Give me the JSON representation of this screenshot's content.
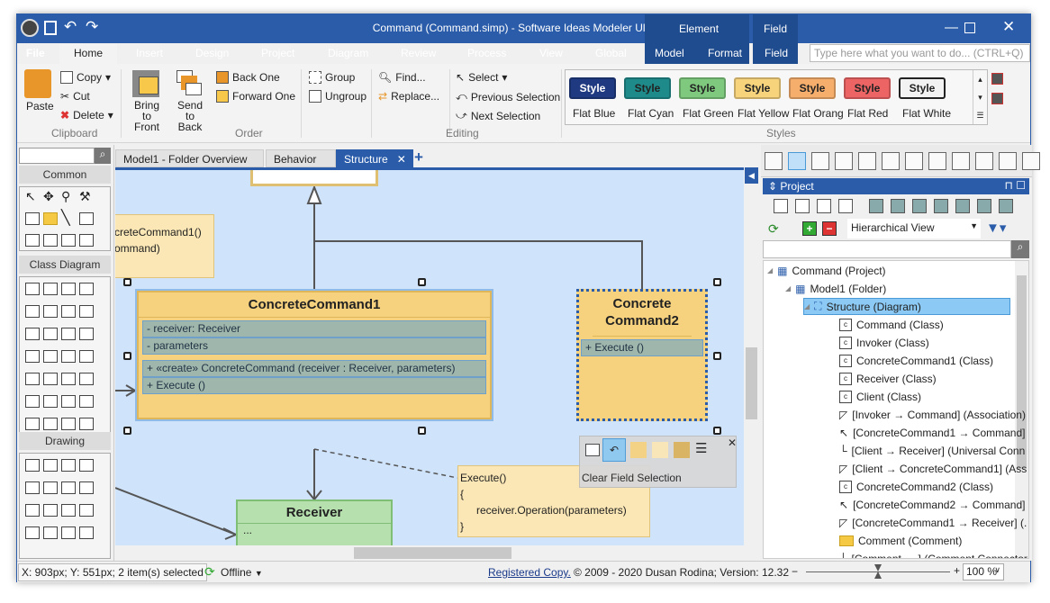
{
  "window": {
    "title": "Command (Command.simp) - Software Ideas Modeler Ultimate",
    "context_groups": [
      "Element",
      "Field"
    ]
  },
  "menu": {
    "tabs": [
      "File",
      "Home",
      "Insert",
      "Design",
      "Project",
      "Diagram",
      "Review",
      "Process",
      "View",
      "Global",
      "Model",
      "Format",
      "Field"
    ],
    "active": "Home",
    "search_placeholder": "Type here what you want to do...  (CTRL+Q)"
  },
  "ribbon": {
    "clipboard": {
      "label": "Clipboard",
      "paste": "Paste",
      "copy": "Copy",
      "cut": "Cut",
      "delete": "Delete"
    },
    "order": {
      "label": "Order",
      "bring_to_front": "Bring to Front",
      "send_to_back": "Send to Back",
      "back_one": "Back One",
      "forward_one": "Forward One",
      "group": "Group",
      "ungroup": "Ungroup"
    },
    "editing": {
      "label": "Editing",
      "find": "Find...",
      "replace": "Replace...",
      "select": "Select",
      "previous_selection": "Previous Selection",
      "next_selection": "Next Selection"
    },
    "styles": {
      "label": "Styles",
      "button_text": "Style",
      "items": [
        {
          "name": "Flat Blue",
          "bg": "#1f3a80",
          "fg": "#ffffff"
        },
        {
          "name": "Flat Cyan",
          "bg": "#1e8a8a",
          "fg": "#222222"
        },
        {
          "name": "Flat Green",
          "bg": "#7ec97e",
          "fg": "#222222"
        },
        {
          "name": "Flat Yellow",
          "bg": "#f7d37c",
          "fg": "#222222"
        },
        {
          "name": "Flat Orang",
          "bg": "#f6ae6c",
          "fg": "#222222"
        },
        {
          "name": "Flat Red",
          "bg": "#ec6464",
          "fg": "#222222"
        },
        {
          "name": "Flat White",
          "bg": "#f2f2f2",
          "fg": "#222222"
        }
      ]
    }
  },
  "toolbox": {
    "sections": [
      "Common",
      "Class Diagram",
      "Drawing"
    ]
  },
  "doc_tabs": [
    "Model1 - Folder Overview",
    "Behavior",
    "Structure"
  ],
  "diagram": {
    "note1": [
      "creteCommand1()",
      "ommand)"
    ],
    "cc1": {
      "name": "ConcreteCommand1",
      "attributes": [
        "- receiver: Receiver",
        "- parameters"
      ],
      "operations": [
        "+ «create» ConcreteCommand (receiver : Receiver, parameters)",
        "+ Execute ()"
      ]
    },
    "cc2": {
      "name": "Concrete Command2",
      "operations": [
        "+ Execute ()"
      ]
    },
    "receiver": {
      "name": "Receiver",
      "body": "..."
    },
    "note2": [
      "Execute()",
      "{",
      "receiver.Operation(parameters)",
      "}"
    ],
    "floating_toolbar": {
      "tooltip": "Clear Field Selection"
    }
  },
  "project_panel": {
    "title": "Project",
    "view": "Hierarchical View",
    "tree": [
      {
        "label": "Command (Project)",
        "level": 0,
        "icon": "project"
      },
      {
        "label": "Model1 (Folder)",
        "level": 1,
        "icon": "folder"
      },
      {
        "label": "Structure (Diagram)",
        "level": 2,
        "icon": "diagram",
        "selected": true
      },
      {
        "label": "Command (Class)",
        "level": 3,
        "icon": "class"
      },
      {
        "label": "Invoker (Class)",
        "level": 3,
        "icon": "class"
      },
      {
        "label": "ConcreteCommand1 (Class)",
        "level": 3,
        "icon": "class"
      },
      {
        "label": "Receiver (Class)",
        "level": 3,
        "icon": "class"
      },
      {
        "label": "Client (Class)",
        "level": 3,
        "icon": "class"
      },
      {
        "label": "[Invoker → Command] (Association)",
        "level": 3,
        "icon": "association"
      },
      {
        "label": "[ConcreteCommand1 → Command]",
        "level": 3,
        "icon": "generalization"
      },
      {
        "label": "[Client → Receiver] (Universal Conn",
        "level": 3,
        "icon": "connector"
      },
      {
        "label": "[Client → ConcreteCommand1] (Ass",
        "level": 3,
        "icon": "association"
      },
      {
        "label": "ConcreteCommand2 (Class)",
        "level": 3,
        "icon": "class"
      },
      {
        "label": "[ConcreteCommand2 → Command]",
        "level": 3,
        "icon": "generalization"
      },
      {
        "label": "[ConcreteCommand1 → Receiver] (.",
        "level": 3,
        "icon": "association"
      },
      {
        "label": "Comment (Comment)",
        "level": 3,
        "icon": "comment"
      },
      {
        "label": "[Comment → ] (Comment Connector",
        "level": 3,
        "icon": "connector"
      }
    ]
  },
  "status": {
    "position": "X: 903px; Y: 551px; 2 item(s) selected",
    "online": "Offline",
    "registered": "Registered Copy.",
    "copyright": "© 2009 - 2020 Dusan Rodina; Version: 12.32",
    "zoom": "100 %",
    "zoom_slider_percent": 50
  }
}
